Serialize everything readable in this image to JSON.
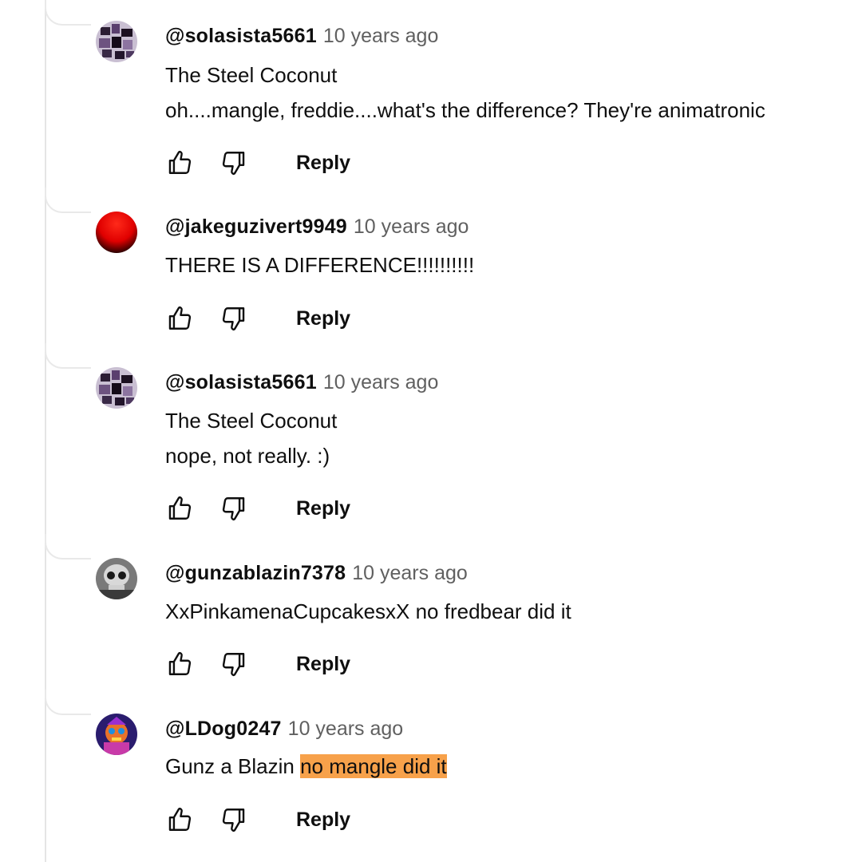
{
  "comments": [
    {
      "handle": "@solasista5661",
      "time": "10 years ago",
      "lines": [
        "The Steel Coconut",
        "oh....mangle, freddie....what's the difference? They're animatronic"
      ],
      "reply_label": "Reply",
      "avatar": "mosaic-purple"
    },
    {
      "handle": "@jakeguzivert9949",
      "time": "10 years ago",
      "lines": [
        "THERE IS A DIFFERENCE!!!!!!!!!!"
      ],
      "reply_label": "Reply",
      "avatar": "red-sphere"
    },
    {
      "handle": "@solasista5661",
      "time": "10 years ago",
      "lines": [
        "The Steel Coconut",
        "nope, not really. :)"
      ],
      "reply_label": "Reply",
      "avatar": "mosaic-purple"
    },
    {
      "handle": "@gunzablazin7378",
      "time": "10 years ago",
      "lines": [
        "XxPinkamenaCupcakesxX no fredbear did it"
      ],
      "reply_label": "Reply",
      "avatar": "grey-skull"
    },
    {
      "handle": "@LDog0247",
      "time": "10 years ago",
      "mention": "Gunz a Blazin ",
      "highlighted_text": "no mangle did it",
      "reply_label": "Reply",
      "avatar": "colorful-character"
    }
  ],
  "icons": {
    "like": "thumbs-up-icon",
    "dislike": "thumbs-down-icon"
  },
  "colors": {
    "highlight": "#f7a14a",
    "timestamp": "#606060",
    "text": "#0f0f0f"
  }
}
